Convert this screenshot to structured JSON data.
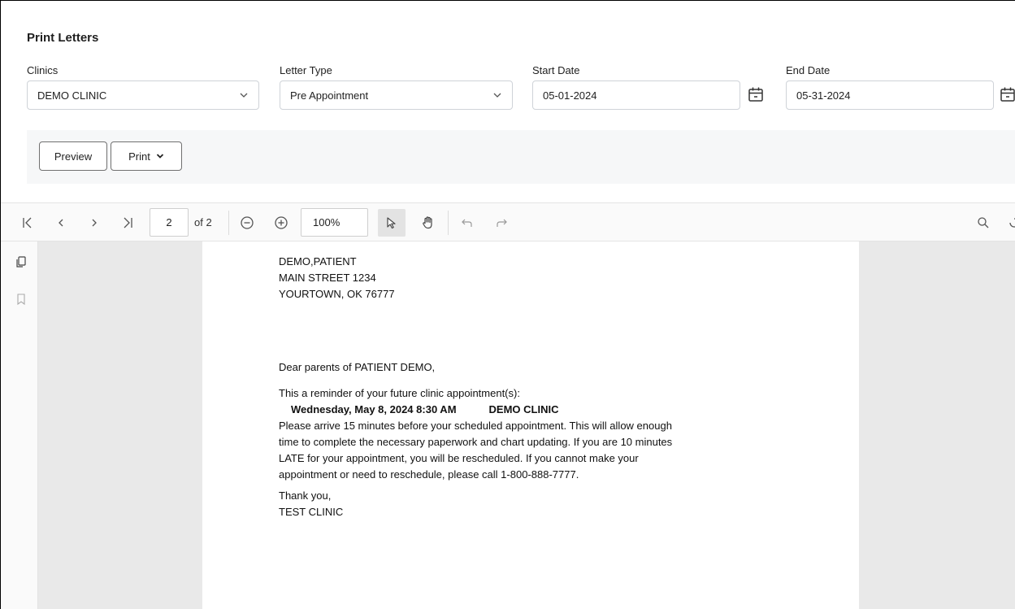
{
  "page_title": "Print Letters",
  "fields": {
    "clinics": {
      "label": "Clinics",
      "value": "DEMO CLINIC"
    },
    "letter_type": {
      "label": "Letter Type",
      "value": "Pre Appointment"
    },
    "start_date": {
      "label": "Start Date",
      "value": "05-01-2024"
    },
    "end_date": {
      "label": "End Date",
      "value": "05-31-2024"
    }
  },
  "actions": {
    "preview": "Preview",
    "print": "Print"
  },
  "viewer": {
    "current_page": "2",
    "page_count_label": "of 2",
    "zoom": "100%"
  },
  "letter": {
    "address": [
      "DEMO,PATIENT",
      "MAIN STREET  1234",
      "YOURTOWN, OK 76777"
    ],
    "greeting": "Dear parents of PATIENT DEMO,",
    "intro": "This a reminder of your future clinic appointment(s):",
    "appointment_datetime": "Wednesday, May 8, 2024 8:30 AM",
    "appointment_clinic": "DEMO CLINIC",
    "body_lines": [
      "Please arrive 15 minutes before your scheduled appointment. This will allow enough",
      "time to complete the necessary paperwork and chart updating. If you are 10 minutes",
      "LATE for your appointment, you will be rescheduled. If you cannot make your",
      "appointment or need to reschedule, please call 1-800-888-7777."
    ],
    "closing": "Thank you,",
    "signature": "TEST CLINIC"
  },
  "colors": {
    "border": "#cfd3d8",
    "viewer_bg": "#e9e9e9",
    "action_bar": "#f6f7f8"
  }
}
